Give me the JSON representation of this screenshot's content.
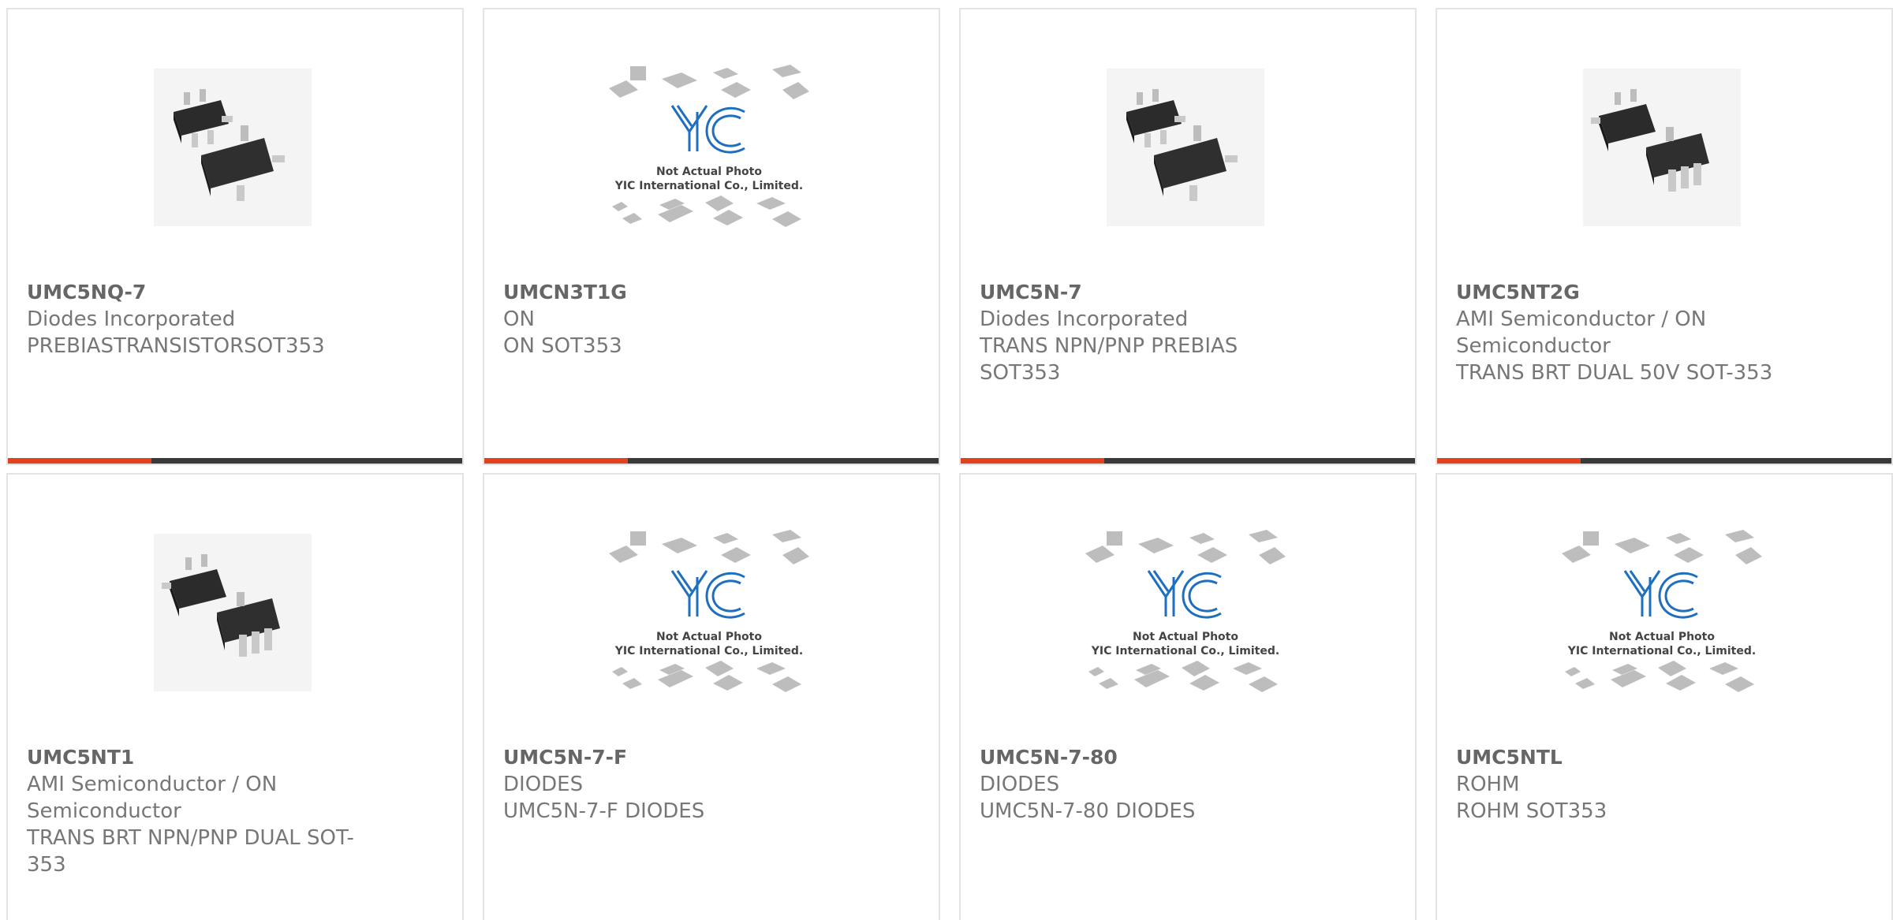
{
  "colors": {
    "accent": "#e2431e",
    "bar": "#3a3a3a",
    "border": "#e3e3e3",
    "text": "#666666"
  },
  "placeholder": {
    "line1": "Not Actual Photo",
    "line2": "YIC International Co., Limited."
  },
  "products": [
    {
      "part": "UMC5NQ-7",
      "manufacturer": "Diodes Incorporated",
      "description": "PREBIASTRANSISTORSOT353",
      "image": "sot353-package-photo"
    },
    {
      "part": "UMCN3T1G",
      "manufacturer": "ON",
      "description": "ON SOT353",
      "image": "yic-placeholder"
    },
    {
      "part": "UMC5N-7",
      "manufacturer": "Diodes Incorporated",
      "description": "TRANS NPN/PNP PREBIAS SOT353",
      "image": "sot353-package-photo"
    },
    {
      "part": "UMC5NT2G",
      "manufacturer": "AMI Semiconductor / ON Semiconductor",
      "description": "TRANS BRT DUAL 50V SOT-353",
      "image": "sot353-package-photo-alt"
    },
    {
      "part": "UMC5NT1",
      "manufacturer": "AMI Semiconductor / ON Semiconductor",
      "description": "TRANS BRT NPN/PNP DUAL SOT-353",
      "image": "sot353-package-photo-alt"
    },
    {
      "part": "UMC5N-7-F",
      "manufacturer": "DIODES",
      "description": "UMC5N-7-F DIODES",
      "image": "yic-placeholder"
    },
    {
      "part": "UMC5N-7-80",
      "manufacturer": "DIODES",
      "description": "UMC5N-7-80 DIODES",
      "image": "yic-placeholder"
    },
    {
      "part": "UMC5NTL",
      "manufacturer": "ROHM",
      "description": "ROHM SOT353",
      "image": "yic-placeholder"
    }
  ]
}
